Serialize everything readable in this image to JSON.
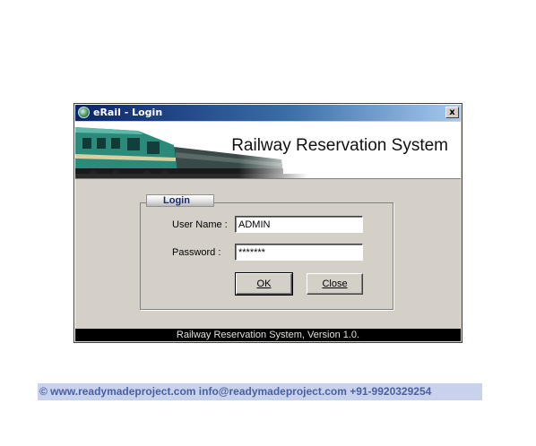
{
  "window": {
    "title": "eRail - Login",
    "close_label": "x"
  },
  "banner": {
    "title": "Railway Reservation System"
  },
  "login_group": {
    "label": "Login",
    "username_label": "User Name :",
    "username_value": "ADMIN",
    "password_label": "Password :",
    "password_value": "*******",
    "ok_label": "OK",
    "close_label": "Close"
  },
  "status": {
    "text": "Railway Reservation System, Version 1.0."
  },
  "footer": {
    "text": "©  www.readymadeproject.com  info@readymadeproject.com  +91-9920329254"
  },
  "icons": {
    "app": "globe-icon",
    "banner_image": "train-illustration"
  },
  "colors": {
    "titlebar_start": "#0a246a",
    "titlebar_end": "#a6caf0",
    "dialog_bg": "#d4d0c8",
    "train_body": "#2b8a7a",
    "footer_bg": "#c9d2ec",
    "footer_text": "#4a5fa0"
  }
}
